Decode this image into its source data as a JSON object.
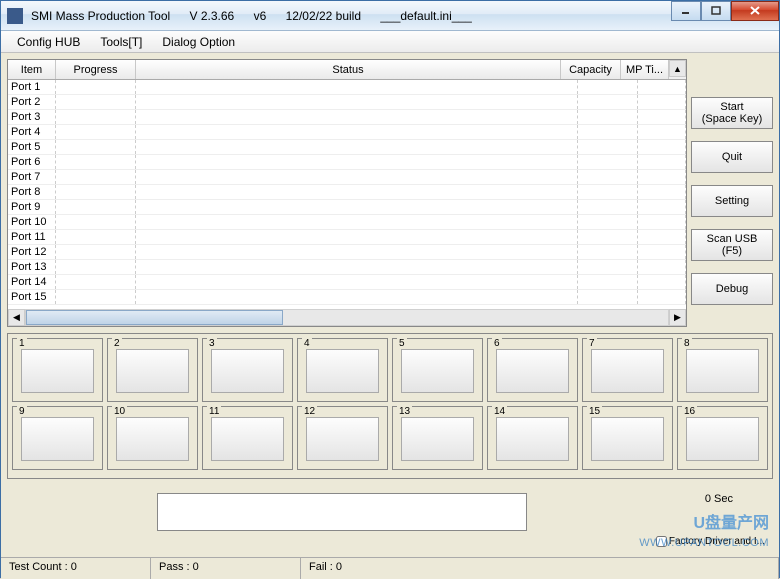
{
  "title": {
    "app": "SMI Mass Production Tool",
    "version": "V 2.3.66",
    "v_short": "v6",
    "build": "12/02/22 build",
    "ini": "___default.ini___"
  },
  "menu": {
    "config": "Config HUB",
    "tools": "Tools[T]",
    "dialog": "Dialog Option"
  },
  "columns": {
    "item": "Item",
    "progress": "Progress",
    "status": "Status",
    "capacity": "Capacity",
    "mp": "MP Ti..."
  },
  "ports": [
    "Port 1",
    "Port 2",
    "Port 3",
    "Port 4",
    "Port 5",
    "Port 6",
    "Port 7",
    "Port 8",
    "Port 9",
    "Port 10",
    "Port 11",
    "Port 12",
    "Port 13",
    "Port 14",
    "Port 15"
  ],
  "buttons": {
    "start1": "Start",
    "start2": "(Space Key)",
    "quit": "Quit",
    "setting": "Setting",
    "scan1": "Scan USB",
    "scan2": "(F5)",
    "debug": "Debug"
  },
  "grid": [
    "1",
    "2",
    "3",
    "4",
    "5",
    "6",
    "7",
    "8",
    "9",
    "10",
    "11",
    "12",
    "13",
    "14",
    "15",
    "16"
  ],
  "sec": "0 Sec",
  "factory": "Factory Driver and I...",
  "status": {
    "test": "Test Count : 0",
    "pass": "Pass : 0",
    "fail": "Fail : 0"
  },
  "watermark": {
    "text": "U盘量产网",
    "url": "WWW.UPANTOOL.COM"
  }
}
